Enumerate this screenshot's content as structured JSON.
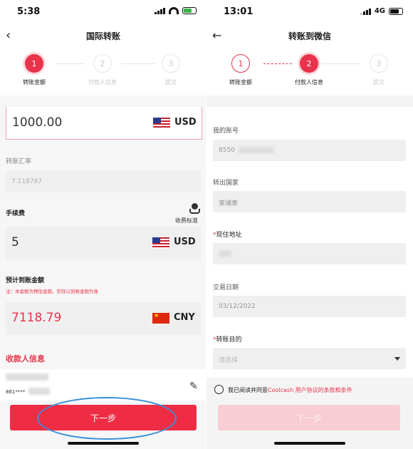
{
  "left": {
    "status": {
      "time": "5:38"
    },
    "nav": {
      "back_icon": "chevron-left-icon",
      "title": "国际转账"
    },
    "steps": [
      {
        "number": "1",
        "label": "转账金额",
        "state": "active"
      },
      {
        "number": "2",
        "label": "付款人信息",
        "state": "faint"
      },
      {
        "number": "3",
        "label": "提交",
        "state": "faint"
      }
    ],
    "amount": {
      "value": "1000.00",
      "currency": "USD"
    },
    "rate": {
      "label": "转账汇率",
      "value": "7.118787"
    },
    "fee": {
      "label": "手续费",
      "standard_label": "收费标准",
      "value": "5",
      "currency": "USD"
    },
    "receive": {
      "label": "预计到账金额",
      "note": "注：本金额为预估金额，实际以到账金额为准",
      "value": "7118.79",
      "currency": "CNY"
    },
    "payee": {
      "title": "收款人信息",
      "account": "861****",
      "edit_icon": "pencil-icon"
    },
    "next_button": "下一步"
  },
  "right": {
    "status": {
      "time": "13:01",
      "network": "4G"
    },
    "nav": {
      "back_icon": "arrow-left-icon",
      "title": "转账到微信"
    },
    "steps": [
      {
        "number": "1",
        "label": "转账金额",
        "state": "done"
      },
      {
        "number": "2",
        "label": "付款人信息",
        "state": "active"
      },
      {
        "number": "3",
        "label": "提交",
        "state": "faint"
      }
    ],
    "account": {
      "label": "我的账号",
      "value": "8550"
    },
    "country": {
      "label": "转出国家",
      "value": "柬埔寨"
    },
    "address": {
      "required": "*",
      "label": "现住地址"
    },
    "date": {
      "label": "交易日期",
      "value": "03/12/2022"
    },
    "purpose": {
      "required": "*",
      "label": "转账目的",
      "placeholder": "请选择"
    },
    "agreement": {
      "prefix": "我已阅读并同意",
      "link": "Coolcash 用户协议的条款和条件"
    },
    "next_button": "下一步"
  },
  "colors": {
    "accent": "#ee2d45",
    "annotation": "#3a8fd8"
  }
}
